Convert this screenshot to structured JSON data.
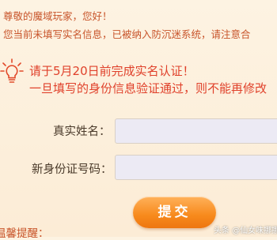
{
  "header": {
    "greeting": "尊敬的魔域玩家，您好！",
    "notice": "您当前未填写实名信息，已被纳入防沉迷系统，请注意合"
  },
  "warning": {
    "icon": "lightbulb-warning-icon",
    "line1": "请于5月20日前完成实名认证！",
    "line2": "一旦填写的身份信息验证通过，则不能再修改"
  },
  "form": {
    "name_label": "真实姓名：",
    "name_value": "",
    "id_label": "新身份证号码：",
    "id_value": "",
    "submit_label": "提交"
  },
  "footer": {
    "reminder": "温馨提醒："
  },
  "watermark": "头条 @仙女味挪挪",
  "colors": {
    "text_orange": "#c8542a",
    "warning_red": "#e0412b",
    "button_orange": "#f78a1c",
    "background": "#fdf3e2"
  }
}
